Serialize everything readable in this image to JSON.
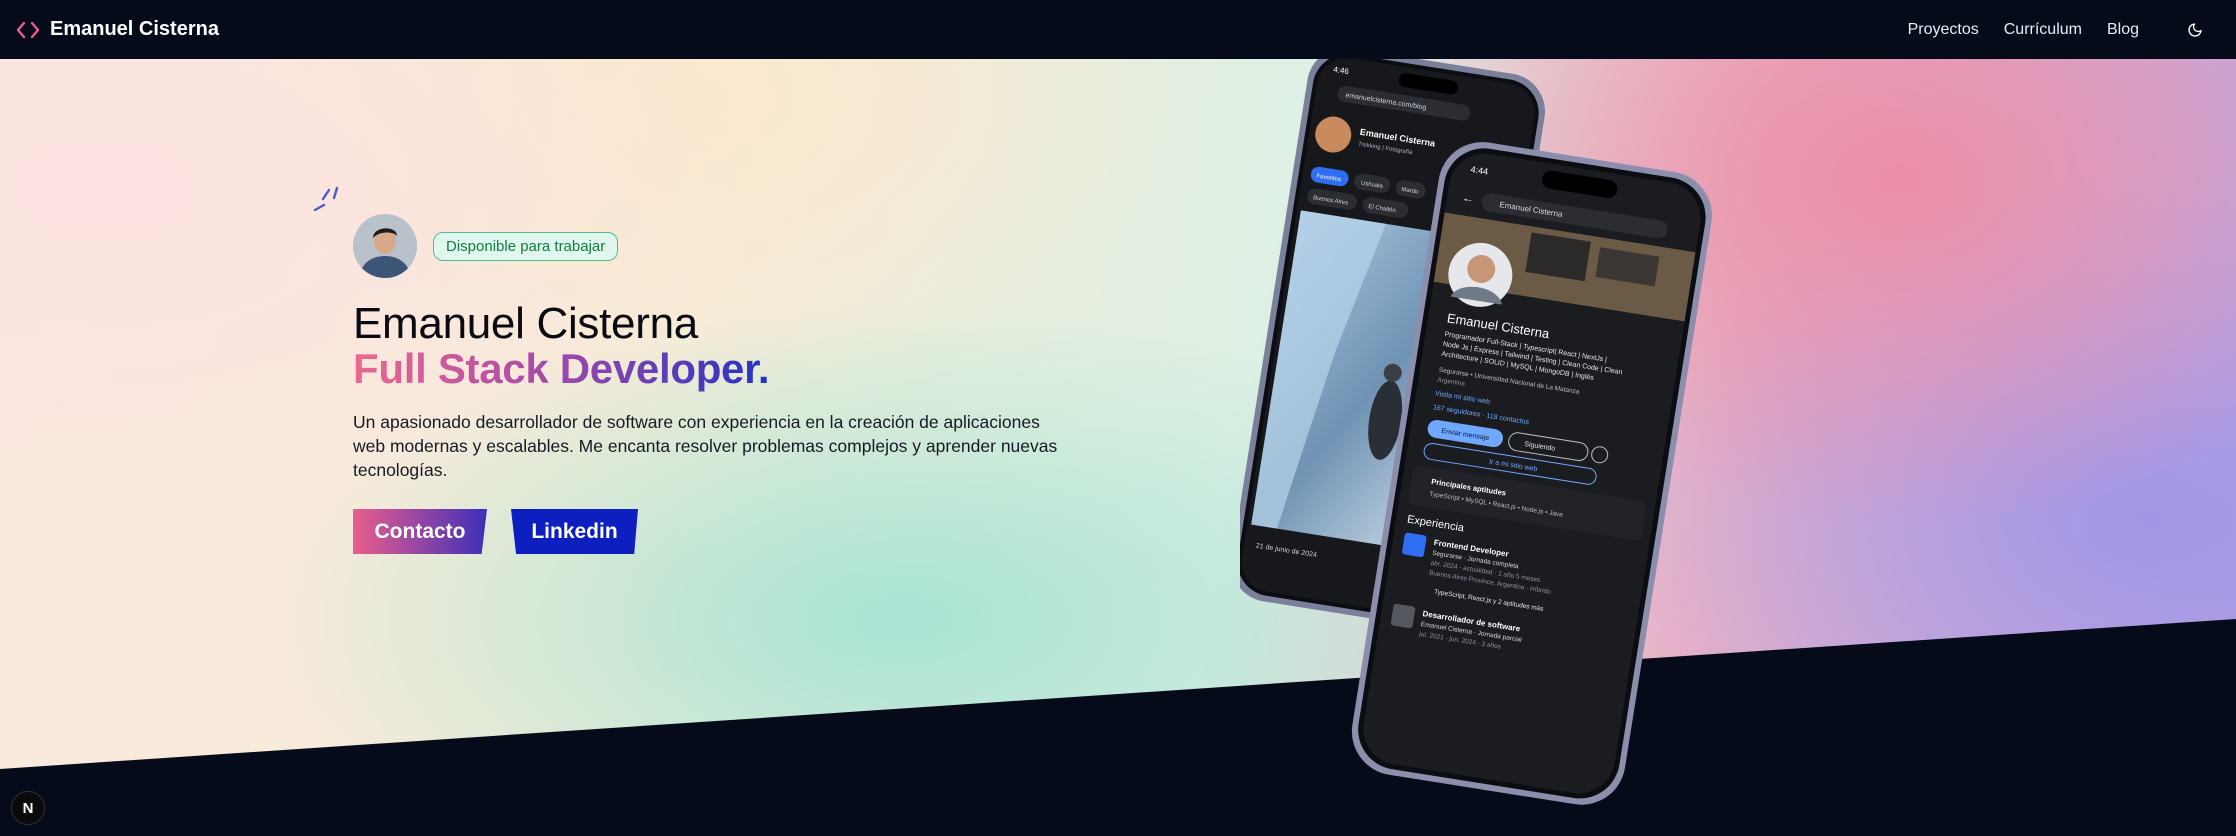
{
  "header": {
    "brand_name": "Emanuel Cisterna",
    "nav": [
      {
        "label": "Proyectos"
      },
      {
        "label": "Currículum"
      },
      {
        "label": "Blog"
      }
    ],
    "theme_icon": "moon-icon"
  },
  "hero": {
    "badge": "Disponible para trabajar",
    "name": "Emanuel Cisterna",
    "role": "Full Stack Developer.",
    "description": "Un apasionado desarrollador de software con experiencia en la creación de aplicaciones web modernas y escalables. Me encanta resolver problemas complejos y aprender nuevas tecnologías.",
    "buttons": {
      "contact": "Contacto",
      "linkedin": "Linkedin"
    }
  },
  "phone_back": {
    "time": "4:46",
    "url": "emanuelcisterna.com/blog",
    "profile_name": "Emanuel Cisterna",
    "profile_sub": "Trekking | Fotografía",
    "chips": [
      "Favoritos",
      "Ushuaia",
      "Mardo",
      "Buenos Aires",
      "El Chaltén"
    ],
    "photo_date": "21 de junio de 2024"
  },
  "phone_front": {
    "time": "4:44",
    "search": "Emanuel Cisterna",
    "name": "Emanuel Cisterna",
    "headline_1": "Programador Full-Stack | Typescript| React | NextJs |",
    "headline_2": "Node Js | Express | Tailwind | Testing | Clean Code | Clean",
    "headline_3": "Architecture | SOLID | MySQL | MongoDB | Inglés",
    "edu": "Segurarse • Universidad Nacional de La Matanza",
    "location": "Argentina",
    "website": "Visita mi sitio web",
    "followers": "167 seguidores · 118 contactos",
    "btn_message": "Enviar mensaje",
    "btn_following": "Siguiendo",
    "btn_site": "Ir a mi sitio web",
    "skills_title": "Principales aptitudes",
    "skills_list": "TypeScript • MySQL • React.js • Node.js • Java",
    "experience_title": "Experiencia",
    "job1_title": "Frontend Developer",
    "job1_company": "Segurarse · Jornada completa",
    "job1_dates": "abr. 2024 - actualidad · 1 año 5 meses",
    "job1_location": "Buenos Aires Province, Argentina · Híbrido",
    "job1_skills": "TypeScript, React.js y 2 aptitudes más",
    "job2_title": "Desarrollador de software",
    "job2_company": "Emanuel Cisterna · Jornada parcial",
    "job2_dates": "jul. 2021 - jun. 2024 · 3 años"
  },
  "dev_badge": "N",
  "colors": {
    "header_bg": "#050b18",
    "accent_pink": "#ec6a8f",
    "accent_blue": "#0d1fbf",
    "badge_green": "#157a4a"
  }
}
